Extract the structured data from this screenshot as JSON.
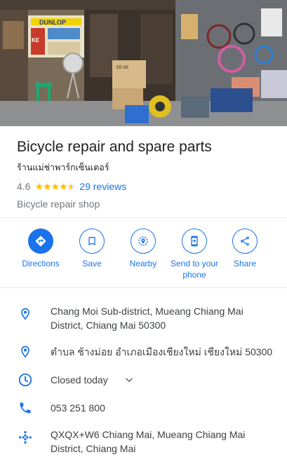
{
  "place": {
    "name": "Bicycle repair and spare parts",
    "local_name": "ร้านแม่ช่าพาร์กเซ็นเตอร์",
    "rating": "4.6",
    "stars": 4.5,
    "reviews": "29 reviews",
    "category": "Bicycle repair shop"
  },
  "hero": {
    "signs": [
      "DUNLOP",
      "KE"
    ],
    "box_label": "EE-99"
  },
  "actions": [
    {
      "label": "Directions",
      "icon": "directions-icon"
    },
    {
      "label": "Save",
      "icon": "bookmark-icon"
    },
    {
      "label": "Nearby",
      "icon": "nearby-icon"
    },
    {
      "label": "Send to your phone",
      "icon": "send-to-phone-icon"
    },
    {
      "label": "Share",
      "icon": "share-icon"
    }
  ],
  "details": {
    "address_en": "Chang Moi Sub-district, Mueang Chiang Mai District, Chiang Mai 50300",
    "address_th": "ตำบล ช้างม่อย อำเภอเมืองเชียงใหม่ เชียงใหม่ 50300",
    "hours_status": "Closed today",
    "phone": "053 251 800",
    "plus_code": "QXQX+W6 Chiang Mai, Mueang Chiang Mai District, Chiang Mai"
  },
  "colors": {
    "accent": "#1a73e8",
    "star": "#fbbc04",
    "closed": "#d93025",
    "muted": "#70757a"
  }
}
